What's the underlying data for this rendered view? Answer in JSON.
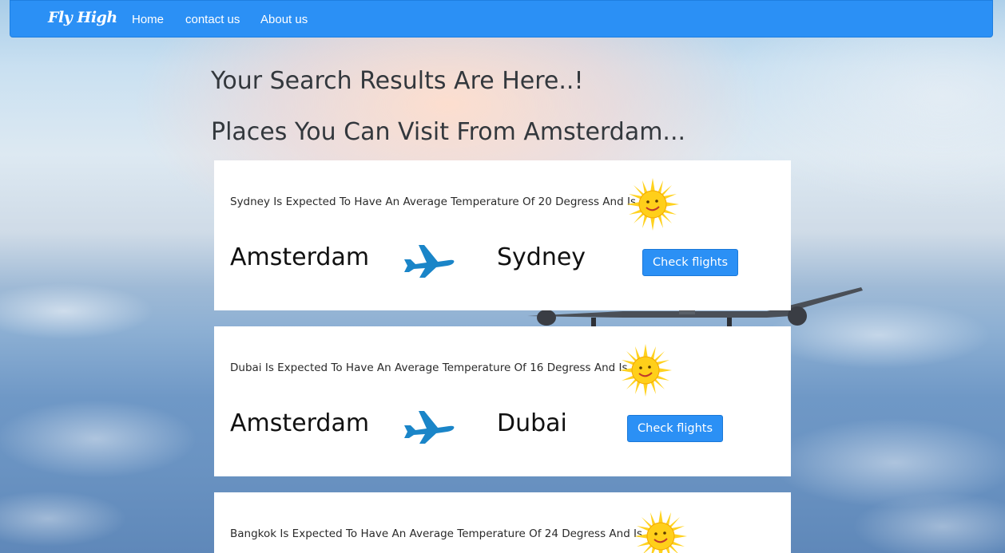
{
  "navbar": {
    "brand": "Fly High",
    "links": [
      "Home",
      "contact us",
      "About us"
    ]
  },
  "headings": {
    "results": "Your Search Results Are Here..!",
    "places": "Places You Can Visit From Amsterdam..."
  },
  "results": [
    {
      "forecast": "Sydney Is Expected To Have An Average Temperature Of 20 Degress And Is",
      "from": "Amsterdam",
      "to": "Sydney",
      "button": "Check flights",
      "weather_icon": "sun-icon"
    },
    {
      "forecast": "Dubai Is Expected To Have An Average Temperature Of 16 Degress And Is",
      "from": "Amsterdam",
      "to": "Dubai",
      "button": "Check flights",
      "weather_icon": "sun-icon"
    },
    {
      "forecast": "Bangkok Is Expected To Have An Average Temperature Of 24 Degress And Is",
      "weather_icon": "sun-icon"
    }
  ],
  "colors": {
    "primary": "#2b90f5",
    "plane_icon": "#1a85c8",
    "sun": "#ffd21f"
  }
}
